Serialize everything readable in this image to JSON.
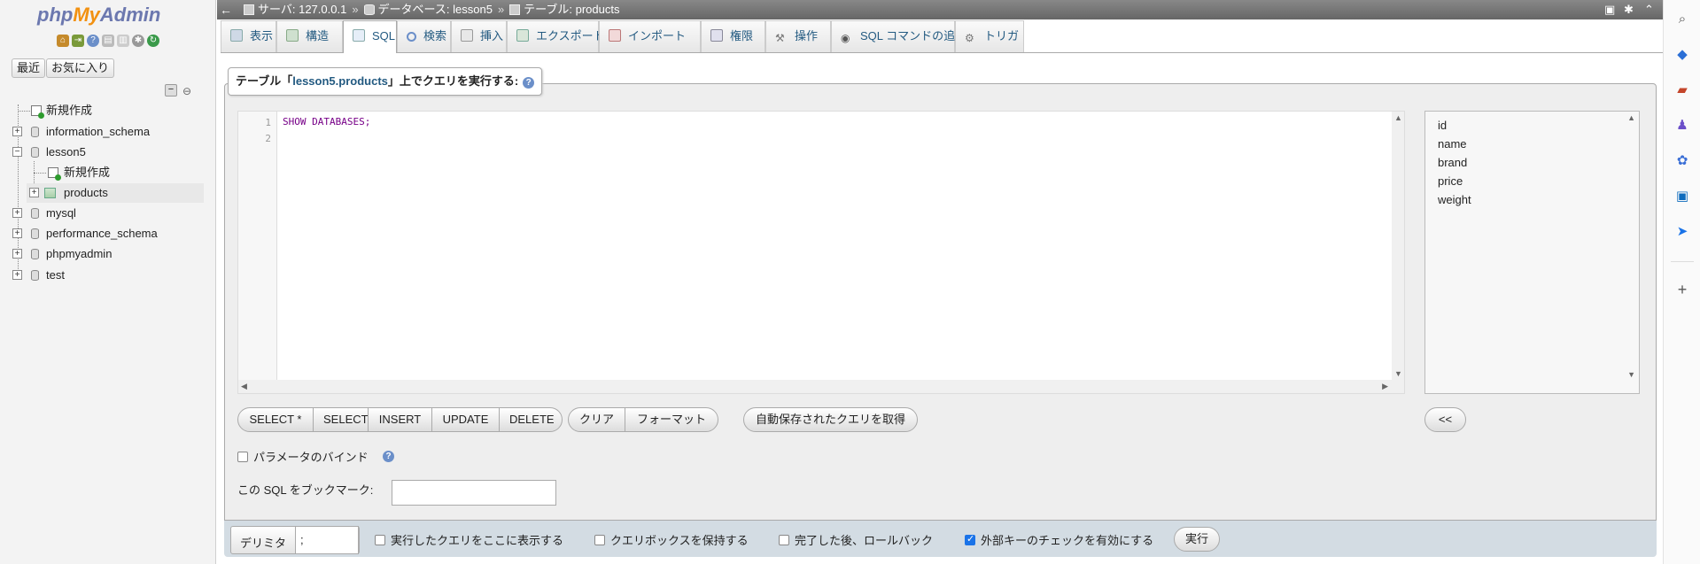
{
  "nav": {
    "logo": {
      "php": "php",
      "my": "My",
      "admin": "Admin"
    },
    "tabs": {
      "recent": "最近",
      "favorites": "お気に入り"
    },
    "tree": [
      {
        "label": "新規作成",
        "type": "new",
        "level": 0
      },
      {
        "label": "information_schema",
        "type": "db",
        "level": 0
      },
      {
        "label": "lesson5",
        "type": "db",
        "level": 0,
        "expanded": true
      },
      {
        "label": "新規作成",
        "type": "new",
        "level": 1
      },
      {
        "label": "products",
        "type": "table",
        "level": 1,
        "selected": true
      },
      {
        "label": "mysql",
        "type": "db",
        "level": 0
      },
      {
        "label": "performance_schema",
        "type": "db",
        "level": 0
      },
      {
        "label": "phpmyadmin",
        "type": "db",
        "level": 0
      },
      {
        "label": "test",
        "type": "db",
        "level": 0
      }
    ]
  },
  "breadcrumb": {
    "server": "サーバ: 127.0.0.1",
    "database": "データベース: lesson5",
    "table": "テーブル: products"
  },
  "tabs": [
    {
      "label": "表示",
      "icon": "browse-icon"
    },
    {
      "label": "構造",
      "icon": "structure-icon"
    },
    {
      "label": "SQL",
      "icon": "sql-icon",
      "active": true
    },
    {
      "label": "検索",
      "icon": "search-icon"
    },
    {
      "label": "挿入",
      "icon": "insert-icon"
    },
    {
      "label": "エクスポート",
      "icon": "export-icon"
    },
    {
      "label": "インポート",
      "icon": "import-icon"
    },
    {
      "label": "権限",
      "icon": "privileges-icon"
    },
    {
      "label": "操作",
      "icon": "wrench-icon"
    },
    {
      "label": "SQL コマンドの追跡",
      "icon": "eye-icon"
    },
    {
      "label": "トリガ",
      "icon": "triggers-icon"
    }
  ],
  "query": {
    "legend_prefix": "テーブル「",
    "legend_table": "lesson5.products",
    "legend_suffix": "」上でクエリを実行する:",
    "lines": [
      "1",
      "2"
    ],
    "code": "SHOW DATABASES;"
  },
  "columns": [
    "id",
    "name",
    "brand",
    "price",
    "weight"
  ],
  "buttons": {
    "select_star": "SELECT *",
    "select": "SELECT",
    "insert": "INSERT",
    "update": "UPDATE",
    "delete": "DELETE",
    "clear": "クリア",
    "format": "フォーマット",
    "get_autosaved": "自動保存されたクエリを取得",
    "insert_column": "<<",
    "go": "実行"
  },
  "options": {
    "bind_params": "パラメータのバインド",
    "bookmark_label": "この SQL をブックマーク:",
    "delimiter_label": "デリミタ",
    "delimiter_value": ";",
    "show_query": "実行したクエリをここに表示する",
    "retain_box": "クエリボックスを保持する",
    "rollback": "完了した後、ロールバック",
    "fk_checks": "外部キーのチェックを有効にする",
    "fk_checks_on": true
  },
  "colors": {
    "accent": "#235a81",
    "logo_blue": "#6c78af",
    "logo_orange": "#f29111",
    "code": "#770088"
  }
}
